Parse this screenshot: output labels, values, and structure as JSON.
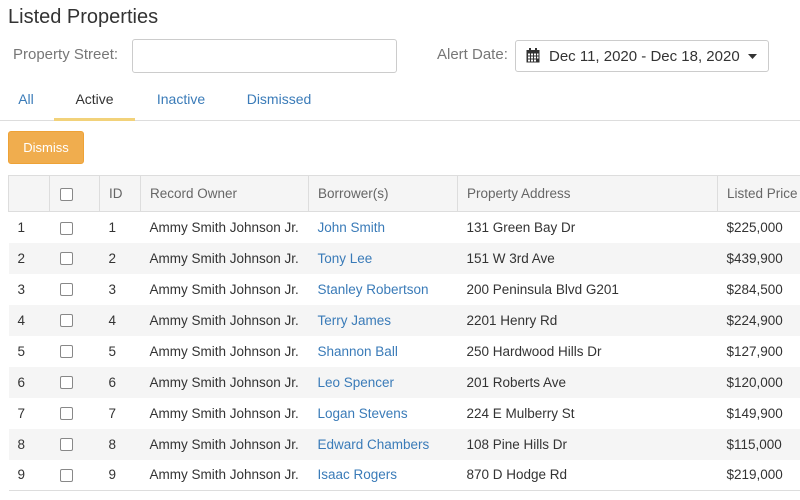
{
  "page": {
    "title": "Listed Properties"
  },
  "filters": {
    "street_label": "Property Street:",
    "street_value": "",
    "alert_label": "Alert Date:",
    "date_range": "Dec 11, 2020 - Dec 18, 2020",
    "date_icon": "calendar-icon",
    "dropdown_icon": "caret-down-icon"
  },
  "tabs": [
    {
      "label": "All",
      "active": false
    },
    {
      "label": "Active",
      "active": true
    },
    {
      "label": "Inactive",
      "active": false
    },
    {
      "label": "Dismissed",
      "active": false
    }
  ],
  "actions": {
    "dismiss_label": "Dismiss"
  },
  "table": {
    "columns": [
      "",
      "",
      "ID",
      "Record Owner",
      "Borrower(s)",
      "Property Address",
      "Listed Price"
    ],
    "rows": [
      {
        "num": "1",
        "id": "1",
        "owner": "Ammy Smith Johnson Jr.",
        "borrower": "John Smith",
        "address": "131 Green Bay Dr",
        "price": "$225,000"
      },
      {
        "num": "2",
        "id": "2",
        "owner": "Ammy Smith Johnson Jr.",
        "borrower": "Tony Lee",
        "address": "151 W 3rd Ave",
        "price": "$439,900"
      },
      {
        "num": "3",
        "id": "3",
        "owner": "Ammy Smith Johnson Jr.",
        "borrower": "Stanley Robertson",
        "address": "200 Peninsula Blvd G201",
        "price": "$284,500"
      },
      {
        "num": "4",
        "id": "4",
        "owner": "Ammy Smith Johnson Jr.",
        "borrower": "Terry James",
        "address": "2201 Henry Rd",
        "price": "$224,900"
      },
      {
        "num": "5",
        "id": "5",
        "owner": "Ammy Smith Johnson Jr.",
        "borrower": "Shannon Ball",
        "address": "250 Hardwood Hills Dr",
        "price": "$127,900"
      },
      {
        "num": "6",
        "id": "6",
        "owner": "Ammy Smith Johnson Jr.",
        "borrower": "Leo Spencer",
        "address": "201 Roberts Ave",
        "price": "$120,000"
      },
      {
        "num": "7",
        "id": "7",
        "owner": "Ammy Smith Johnson Jr.",
        "borrower": "Logan Stevens",
        "address": "224 E Mulberry St",
        "price": "$149,900"
      },
      {
        "num": "8",
        "id": "8",
        "owner": "Ammy Smith Johnson Jr.",
        "borrower": "Edward Chambers",
        "address": "108 Pine Hills Dr",
        "price": "$115,000"
      },
      {
        "num": "9",
        "id": "9",
        "owner": "Ammy Smith Johnson Jr.",
        "borrower": "Isaac Rogers",
        "address": "870 D Hodge Rd",
        "price": "$219,000"
      }
    ]
  },
  "colors": {
    "link": "#3a7bb8",
    "dismiss_button": "#f0ad4e",
    "active_tab_underline": "#f2d27a",
    "header_bg": "#f5f5f5",
    "stripe_bg": "#f5f5f5"
  }
}
